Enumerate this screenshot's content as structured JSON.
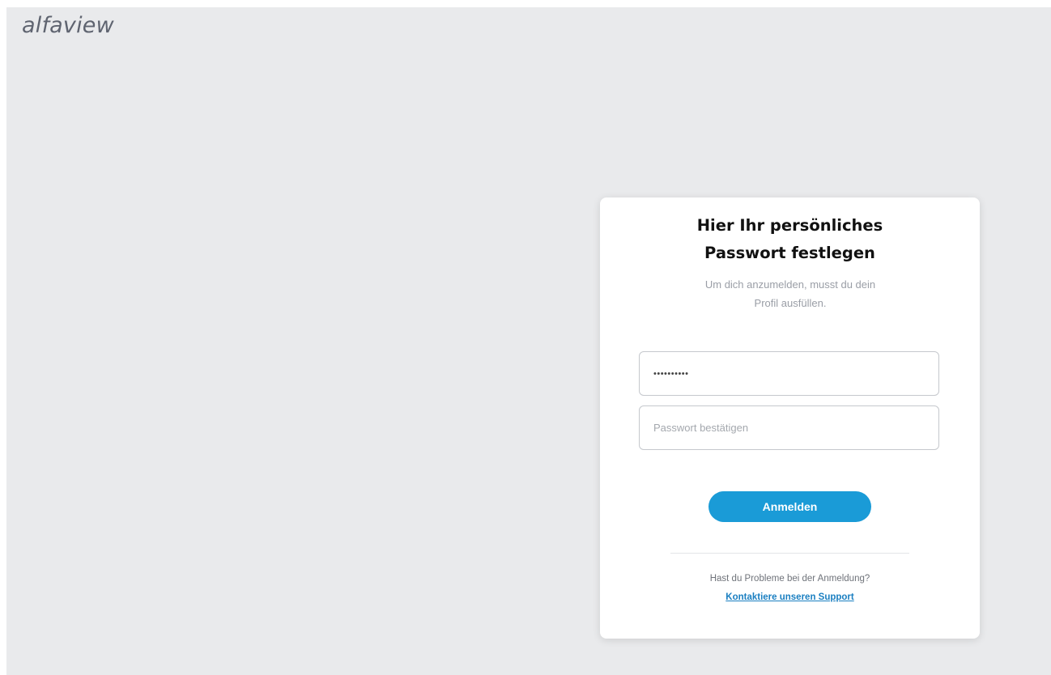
{
  "app": {
    "logo_text": "alfaview"
  },
  "card": {
    "title_line1": "Hier Ihr persönliches",
    "title_line2": "Passwort festlegen",
    "subtitle_line1": "Um dich anzumelden, musst du dein",
    "subtitle_line2": "Profil ausfüllen.",
    "password_field": {
      "value_masked": "••••••••••"
    },
    "confirm_field": {
      "placeholder": "Passwort bestätigen",
      "value": ""
    },
    "login_button_label": "Anmelden",
    "help_text": "Hast du Probleme bei der Anmeldung?",
    "support_link_label": "Kontaktiere unseren Support"
  },
  "colors": {
    "background": "#e9eaec",
    "accent": "#1a9bd7",
    "link": "#1a7fc1"
  }
}
